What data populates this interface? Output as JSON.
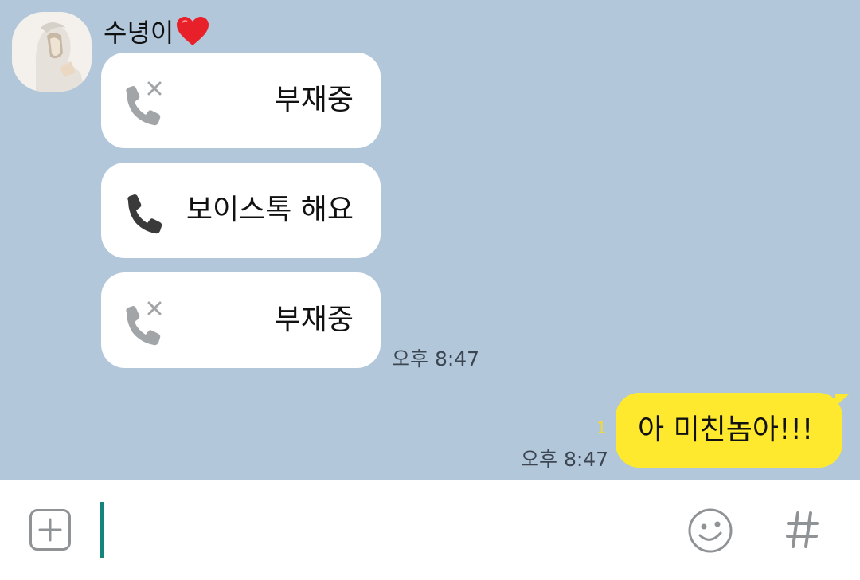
{
  "chat": {
    "sender_name": "수녕이",
    "messages": [
      {
        "type": "missed-call",
        "text": "부재중"
      },
      {
        "type": "voice-talk",
        "text": "보이스톡 해요"
      },
      {
        "type": "missed-call",
        "text": "부재중"
      }
    ],
    "received_time": "오후 8:47",
    "my_message": {
      "text": "아 미친놈아!!!",
      "time": "오후 8:47",
      "unread_count": "1"
    }
  },
  "colors": {
    "chat_background": "#b2c7da",
    "my_bubble": "#fee92e",
    "cursor": "#13857a"
  },
  "icons": [
    "missed-call-icon",
    "phone-icon",
    "add-icon",
    "emoji-icon",
    "hash-icon"
  ]
}
